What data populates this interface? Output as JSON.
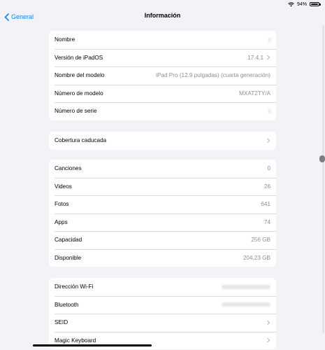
{
  "status": {
    "battery": "94%",
    "battery_level": 0.94
  },
  "nav": {
    "back_label": "General",
    "title": "Información"
  },
  "groups": [
    {
      "rows": [
        {
          "label": "Nombre",
          "value": ""
        },
        {
          "label": "Versión de iPadOS",
          "value": "17.4.1"
        },
        {
          "label": "Nombre del modelo",
          "value": "iPad Pro (12.9 pulgadas) (cuarta generación)"
        },
        {
          "label": "Número de modelo",
          "value": "MXAT2TY/A"
        },
        {
          "label": "Número de serie",
          "value": ""
        }
      ]
    },
    {
      "rows": [
        {
          "label": "Cobertura caducada",
          "value": ""
        }
      ]
    },
    {
      "rows": [
        {
          "label": "Canciones",
          "value": "0"
        },
        {
          "label": "Videos",
          "value": "26"
        },
        {
          "label": "Fotos",
          "value": "641"
        },
        {
          "label": "Apps",
          "value": "74"
        },
        {
          "label": "Capacidad",
          "value": "256 GB"
        },
        {
          "label": "Disponible",
          "value": "204,23 GB"
        }
      ]
    },
    {
      "rows": [
        {
          "label": "Dirección Wi-Fi",
          "value": ""
        },
        {
          "label": "Bluetooth",
          "value": ""
        },
        {
          "label": "SEID",
          "value": ""
        },
        {
          "label": "Magic Keyboard",
          "value": ""
        }
      ]
    }
  ]
}
